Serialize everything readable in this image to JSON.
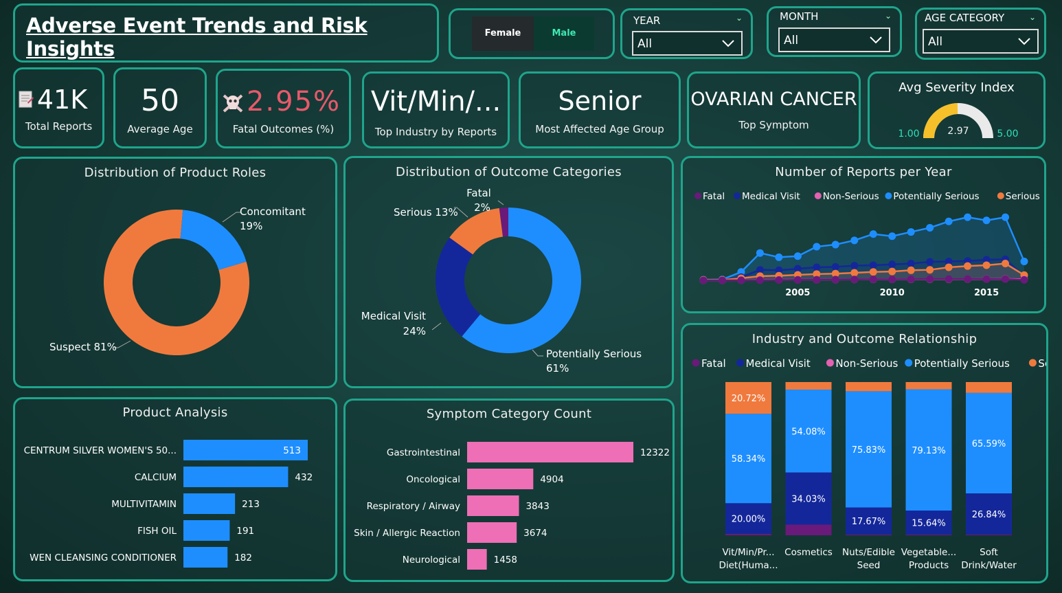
{
  "header": {
    "title": "Adverse Event Trends and Risk Insights"
  },
  "gender": {
    "female": "Female",
    "male": "Male"
  },
  "filters": {
    "year": {
      "label": "YEAR",
      "value": "All"
    },
    "month": {
      "label": "MONTH",
      "value": "All"
    },
    "age": {
      "label": "AGE CATEGORY",
      "value": "All"
    }
  },
  "kpis": {
    "total": {
      "value": "41K",
      "label": "Total Reports"
    },
    "age": {
      "value": "50",
      "label": "Average Age"
    },
    "fatal": {
      "value": "2.95%",
      "label": "Fatal Outcomes (%)"
    },
    "industry": {
      "value": "Vit/Min/...",
      "label": "Top Industry by Reports"
    },
    "agegroup": {
      "value": "Senior",
      "label": "Most Affected Age Group"
    },
    "symptom": {
      "value": "OVARIAN CANCER",
      "label": "Top Symptom"
    },
    "severity": {
      "title": "Avg Severity Index",
      "min": "1.00",
      "max": "5.00",
      "value": "2.97",
      "value_num": 2.97,
      "min_num": 1,
      "max_num": 5
    }
  },
  "colors": {
    "fatal": "#6a1a7a",
    "medical": "#14279a",
    "nonserious": "#e460b0",
    "potential": "#1e8eff",
    "serious": "#f07a3e",
    "suspect": "#f07a3e",
    "concomitant": "#1e8eff",
    "pink": "#ee6fb5",
    "blue": "#1e8eff",
    "gauge": "#f5c02a"
  },
  "icons": {
    "total": "document-icon",
    "fatal": "skull-crossbones-icon"
  },
  "chart_data": [
    {
      "type": "pie",
      "title": "Distribution of Product Roles",
      "labels": [
        "Suspect",
        "Concomitant"
      ],
      "values": [
        81,
        19
      ],
      "label_text": [
        "Suspect 81%",
        "Concomitant",
        "19%"
      ]
    },
    {
      "type": "pie",
      "title": "Distribution of Outcome Categories",
      "labels": [
        "Potentially Serious",
        "Medical Visit",
        "Serious",
        "Fatal"
      ],
      "values": [
        61,
        24,
        13,
        2
      ],
      "label_text": {
        "fatal": [
          "Fatal",
          "2%"
        ],
        "serious": "Serious 13%",
        "medical": [
          "Medical Visit",
          "24%"
        ],
        "potential": [
          "Potentially Serious",
          "61%"
        ]
      }
    },
    {
      "type": "line",
      "title": "Number of Reports per Year",
      "x": [
        2000,
        2001,
        2002,
        2003,
        2004,
        2005,
        2006,
        2007,
        2008,
        2009,
        2010,
        2011,
        2012,
        2013,
        2014,
        2015,
        2016,
        2017
      ],
      "xticks": [
        "2005",
        "2010",
        "2015"
      ],
      "xtick_values": [
        2005,
        2010,
        2015
      ],
      "legend": [
        "Fatal",
        "Medical Visit",
        "Non-Serious",
        "Potentially Serious",
        "Serious"
      ],
      "ylim": [
        0,
        3200
      ],
      "series": [
        {
          "name": "Fatal",
          "values": [
            2,
            2,
            5,
            10,
            15,
            25,
            30,
            35,
            40,
            50,
            50,
            55,
            60,
            60,
            65,
            60,
            60,
            20
          ]
        },
        {
          "name": "Medical Visit",
          "values": [
            10,
            20,
            150,
            500,
            480,
            550,
            620,
            640,
            700,
            720,
            760,
            800,
            880,
            900,
            920,
            980,
            1000,
            200
          ]
        },
        {
          "name": "Non-Serious",
          "values": [
            5,
            5,
            10,
            20,
            25,
            30,
            30,
            35,
            40,
            45,
            50,
            50,
            55,
            55,
            60,
            65,
            70,
            50
          ]
        },
        {
          "name": "Potentially Serious",
          "values": [
            30,
            40,
            400,
            1300,
            1100,
            1150,
            1600,
            1700,
            1900,
            2200,
            2100,
            2300,
            2500,
            2800,
            3000,
            2850,
            3000,
            900
          ]
        },
        {
          "name": "Serious",
          "values": [
            20,
            20,
            100,
            200,
            220,
            260,
            300,
            320,
            360,
            400,
            420,
            480,
            500,
            620,
            680,
            720,
            800,
            250
          ]
        }
      ]
    },
    {
      "type": "bar",
      "title": "Product Analysis",
      "categories": [
        "CENTRUM SILVER WOMEN'S 50...",
        "CALCIUM",
        "MULTIVITAMIN",
        "FISH OIL",
        "WEN CLEANSING CONDITIONER"
      ],
      "values": [
        513,
        432,
        213,
        191,
        182
      ]
    },
    {
      "type": "bar",
      "title": "Symptom Category Count",
      "categories": [
        "Gastrointestinal",
        "Oncological",
        "Respiratory / Airway",
        "Skin / Allergic Reaction",
        "Neurological"
      ],
      "values": [
        12322,
        4904,
        3843,
        3674,
        1458
      ]
    },
    {
      "type": "bar",
      "title": "Industry and Outcome Relationship",
      "stacked": true,
      "normalized": true,
      "legend": [
        "Fatal",
        "Medical Visit",
        "Non-Serious",
        "Potentially Serious",
        "Serious"
      ],
      "categories": [
        [
          "Vit/Min/Pr...",
          "Diet(Huma..."
        ],
        [
          "Cosmetics"
        ],
        [
          "Nuts/Edible",
          "Seed"
        ],
        [
          "Vegetable...",
          "Products"
        ],
        [
          "Soft",
          "Drink/Water"
        ]
      ],
      "series": [
        {
          "name": "Fatal",
          "values": [
            0.95,
            6.97,
            0.5,
            0.5,
            0.5
          ]
        },
        {
          "name": "Medical Visit",
          "values": [
            20.0,
            34.03,
            17.67,
            15.64,
            26.84
          ]
        },
        {
          "name": "Non-Serious",
          "values": [
            0,
            0,
            0,
            0,
            0
          ]
        },
        {
          "name": "Potentially Serious",
          "values": [
            58.34,
            54.08,
            75.83,
            79.13,
            65.59
          ]
        },
        {
          "name": "Serious",
          "values": [
            20.72,
            4.92,
            6.0,
            4.73,
            7.07
          ]
        }
      ],
      "data_labels": [
        [
          "20.00%",
          "58.34%",
          "20.72%"
        ],
        [
          "34.03%",
          "54.08%"
        ],
        [
          "17.67%",
          "75.83%"
        ],
        [
          "15.64%",
          "79.13%"
        ],
        [
          "26.84%",
          "65.59%"
        ]
      ]
    }
  ]
}
